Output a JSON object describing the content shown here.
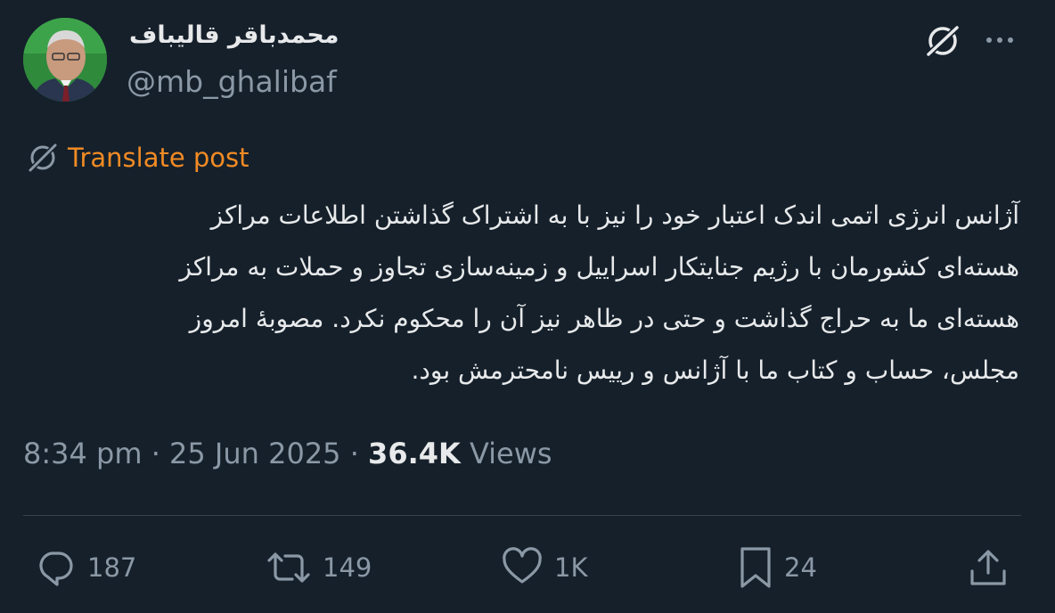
{
  "author": {
    "display_name": "محمدباقر قالیباف",
    "handle": "@mb_ghalibaf",
    "avatar_icon": "profile-photo"
  },
  "header": {
    "grok_icon": "grok-slash-icon",
    "more_icon": "more-horizontal-icon"
  },
  "translate": {
    "label": "Translate post",
    "color": "#f28b24"
  },
  "post": {
    "lines": [
      "آژانس انرژی اتمی اندک اعتبار خود را نیز با به اشتراک گذاشتن اطلاعات مراکز",
      "هسته‌ای کشورمان با رژیم جنایتکار اسراییل و زمینه‌سازی تجاوز و حملات به مراکز",
      "هسته‌ای ما به حراج گذاشت و حتی در ظاهر نیز آن را محکوم نکرد. مصوبهٔ امروز",
      "مجلس، حساب و کتاب ما با آژانس و رییس نامحترمش بود."
    ]
  },
  "meta": {
    "time": "8:34 pm",
    "date": "25 Jun 2025",
    "views_count": "36.4K",
    "views_label": "Views",
    "separator": "·"
  },
  "actions": {
    "replies": "187",
    "reposts": "149",
    "likes": "1K",
    "bookmarks": "24"
  },
  "colors": {
    "background": "#15202b",
    "text": "#e7e9ea",
    "secondary": "#8b98a5",
    "divider": "#38444d"
  }
}
